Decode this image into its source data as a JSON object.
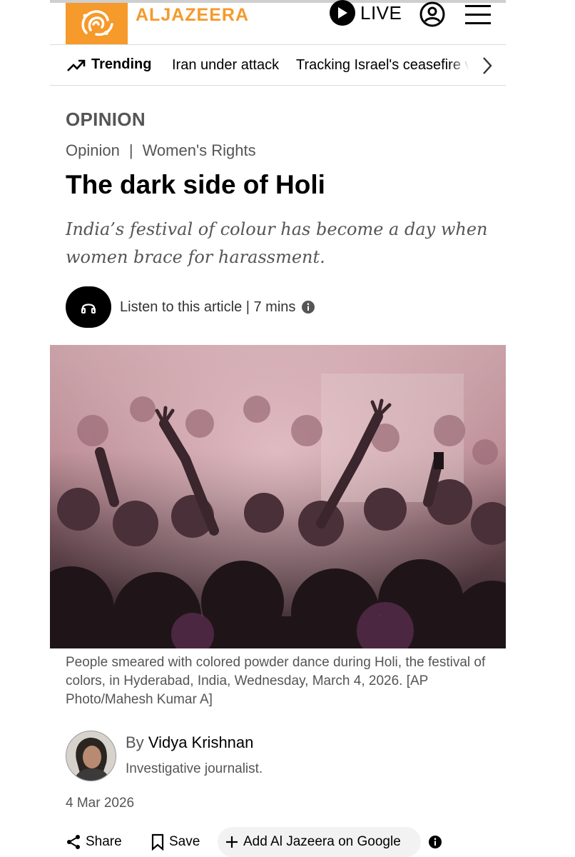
{
  "header": {
    "logo_text": "ALJAZEERA",
    "live_label": "LIVE",
    "brand_color": "#f59a2b"
  },
  "trending": {
    "label": "Trending",
    "items": [
      "Iran under attack",
      "Tracking Israel's ceasefire vi"
    ]
  },
  "article": {
    "section": "OPINION",
    "breadcrumb": [
      "Opinion",
      "|",
      "Women's Rights"
    ],
    "title": "The dark side of Holi",
    "standfirst": "India’s festival of colour has become a day when women brace for harassment.",
    "listen_label": "Listen to this article | 7 mins",
    "caption": "People smeared with colored powder dance during Holi, the festival of colors, in Hyderabad, India, Wednesday, March 4, 2026. [AP Photo/Mahesh Kumar A]",
    "byline_prefix": "By",
    "author": "Vidya Krishnan",
    "author_role": "Investigative journalist.",
    "date": "4 Mar 2026"
  },
  "actions": {
    "share": "Share",
    "save": "Save",
    "add_google": "Add Al Jazeera on Google"
  },
  "icons": [
    "trending-up-icon",
    "play-icon",
    "account-icon",
    "menu-icon",
    "chevron-right-icon",
    "headphones-icon",
    "info-icon",
    "share-icon",
    "bookmark-icon",
    "plus-icon"
  ]
}
